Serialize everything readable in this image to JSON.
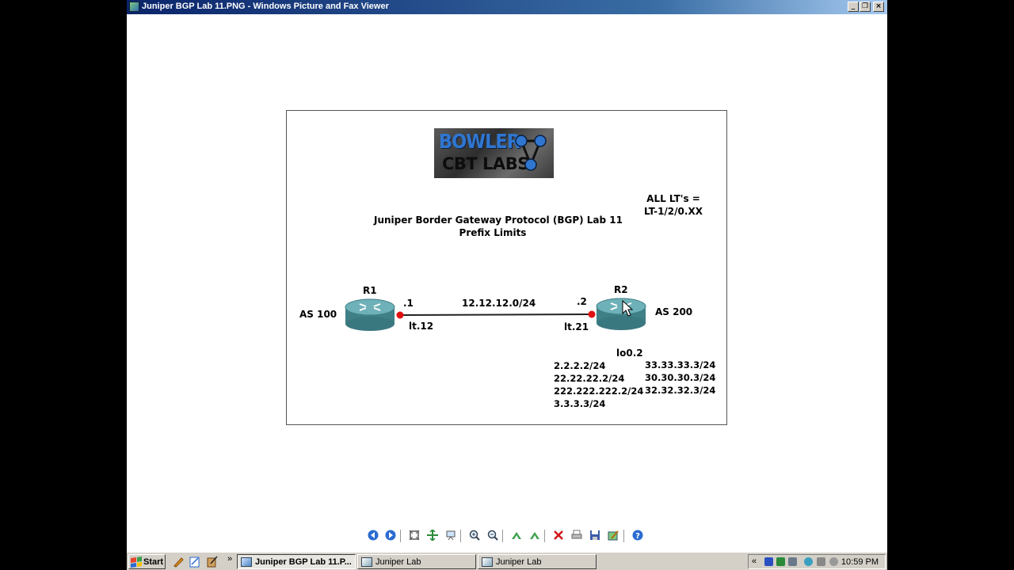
{
  "window": {
    "title": "Juniper BGP Lab 11.PNG - Windows Picture and Fax Viewer",
    "minimize_glyph": "_",
    "maximize_glyph": "❐",
    "close_glyph": "×"
  },
  "diagram": {
    "logo": {
      "line1": "BOWLER",
      "line2": "CBT LABS"
    },
    "lab_title": "Juniper Border Gateway Protocol (BGP) Lab 11",
    "lab_subtitle": "Prefix Limits",
    "lt_note_line1": "ALL LT's =",
    "lt_note_line2": "LT-1/2/0.XX",
    "r1": {
      "name": "R1",
      "as": "AS 100",
      "ip_suffix": ".1",
      "interface": "lt.12"
    },
    "r2": {
      "name": "R2",
      "as": "AS 200",
      "ip_suffix": ".2",
      "interface": "lt.21"
    },
    "link_network": "12.12.12.0/24",
    "loopback_label": "lo0.2",
    "prefixes_left": [
      "2.2.2.2/24",
      "22.22.22.2/24",
      "222.222.222.2/24",
      "3.3.3.3/24"
    ],
    "prefixes_right": [
      "33.33.33.3/24",
      "30.30.30.3/24",
      "32.32.32.3/24"
    ],
    "colors": {
      "router_body": "#4a8c93",
      "interface_dot": "#e01010"
    }
  },
  "toolbar": {
    "icons": [
      "previous-image-icon",
      "next-image-icon",
      "best-fit-icon",
      "actual-size-icon",
      "slideshow-icon",
      "zoom-in-icon",
      "zoom-out-icon",
      "rotate-clockwise-icon",
      "rotate-counterclockwise-icon",
      "delete-icon",
      "print-icon",
      "save-icon",
      "edit-icon",
      "help-icon"
    ]
  },
  "taskbar": {
    "start_label": "Start",
    "quick_launch_more": "»",
    "tasks": [
      {
        "label": "Juniper BGP Lab 11.P...",
        "active": true
      },
      {
        "label": "Juniper Lab",
        "active": false
      },
      {
        "label": "Juniper Lab",
        "active": false
      }
    ],
    "tray_expand": "«",
    "clock": "10:59 PM"
  }
}
